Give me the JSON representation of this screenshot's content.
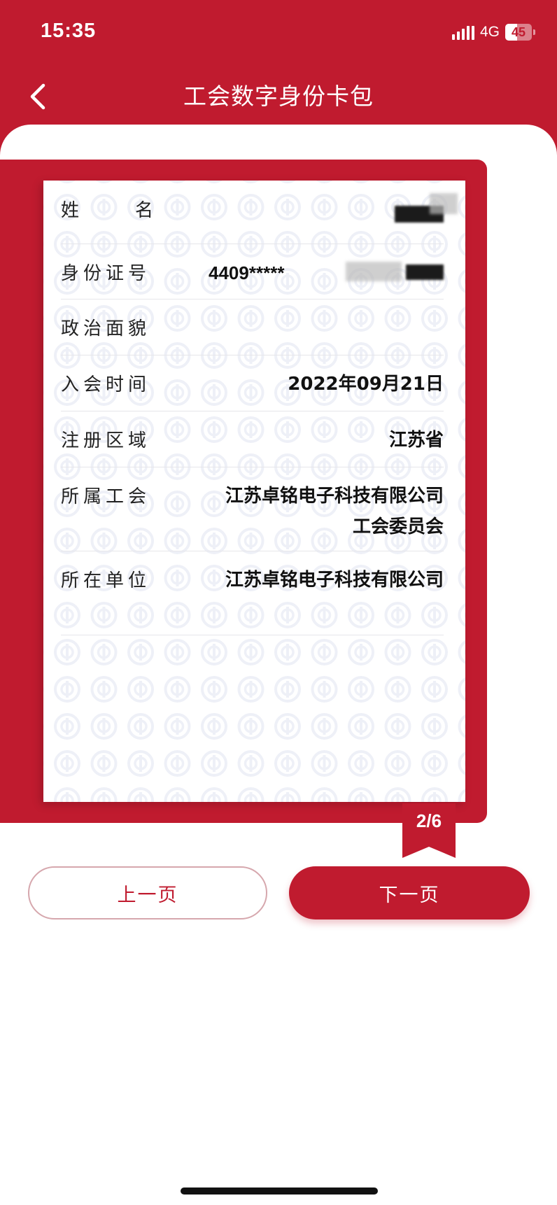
{
  "status_bar": {
    "time": "15:35",
    "network": "4G",
    "battery_level": "45",
    "battery_fraction": 0.45,
    "icons": [
      "signal-icon",
      "battery-icon"
    ]
  },
  "header": {
    "title": "工会数字身份卡包",
    "back_icon": "chevron-left-icon"
  },
  "colors": {
    "brand_red": "#c01b2f",
    "page_bg": "#ffffff",
    "divider": "#e6e6ea",
    "watermark": "#eef0f7"
  },
  "card": {
    "rows": [
      {
        "label": "姓　　名",
        "value": ""
      },
      {
        "label": "身份证号",
        "value": "4409*****"
      },
      {
        "label": "政治面貌",
        "value": ""
      },
      {
        "label": "入会时间",
        "value": "2022年09月21日"
      },
      {
        "label": "注册区域",
        "value": "江苏省"
      },
      {
        "label": "所属工会",
        "value": "江苏卓铭电子科技有限公司工会委员会"
      },
      {
        "label": "所在单位",
        "value": "江苏卓铭电子科技有限公司"
      }
    ],
    "watermark_icon": "union-emblem-icon"
  },
  "pager": {
    "indicator": "2/6",
    "current": 2,
    "total": 6
  },
  "buttons": {
    "prev": "上一页",
    "next": "下一页"
  }
}
